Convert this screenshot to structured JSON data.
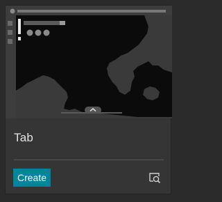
{
  "card": {
    "title": "Tab",
    "create_label": "Create",
    "preview_icon": "preview-zoom-icon",
    "expand_icon": "chevron-up-icon"
  },
  "colors": {
    "page_background": "#2b2b2b",
    "card_background": "#353535",
    "accent": "#00869c",
    "map_background": "#0b0b0b",
    "map_land": "#3a3a3a"
  }
}
